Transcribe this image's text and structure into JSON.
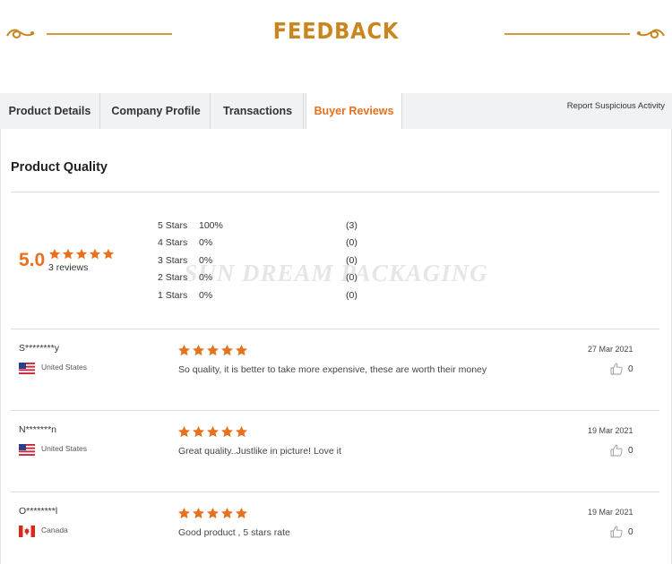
{
  "banner": {
    "title": "FEEDBACK"
  },
  "tabs": [
    {
      "label": "Product Details",
      "active": false
    },
    {
      "label": "Company Profile",
      "active": false
    },
    {
      "label": "Transactions",
      "active": false
    },
    {
      "label": "Buyer Reviews",
      "active": true
    }
  ],
  "report_link": "Report Suspicious Activity",
  "quality": {
    "title": "Product Quality",
    "score": "5.0",
    "stars": 5,
    "review_count": "3 reviews",
    "distribution": [
      {
        "label": "5  Stars",
        "percent": "100%",
        "count": "(3)"
      },
      {
        "label": "4  Stars",
        "percent": "0%",
        "count": "(0)"
      },
      {
        "label": "3  Stars",
        "percent": "0%",
        "count": "(0)"
      },
      {
        "label": "2  Stars",
        "percent": "0%",
        "count": "(0)"
      },
      {
        "label": "1  Stars",
        "percent": "0%",
        "count": "(0)"
      }
    ]
  },
  "watermark": "SUN DREAM PACKAGING",
  "reviews": [
    {
      "reviewer": "S********y",
      "country": "United States",
      "flag_icon": "us-flag-icon",
      "rating": 5,
      "comment": "So quality, it is better to take more expensive, these are worth their money",
      "date": "27 Mar 2021",
      "likes": "0"
    },
    {
      "reviewer": "N*******n",
      "country": "United States",
      "flag_icon": "us-flag-icon",
      "rating": 5,
      "comment": "Great quality..Justlike in picture! Love it",
      "date": "19 Mar 2021",
      "likes": "0"
    },
    {
      "reviewer": "O********l",
      "country": "Canada",
      "flag_icon": "canada-flag-icon",
      "rating": 5,
      "comment": "Good product , 5 stars rate",
      "date": "19 Mar 2021",
      "likes": "0"
    }
  ],
  "colors": {
    "accent": "#e9701e",
    "banner_gold": "#c9861e",
    "tab_bg": "#f1f2f4"
  }
}
